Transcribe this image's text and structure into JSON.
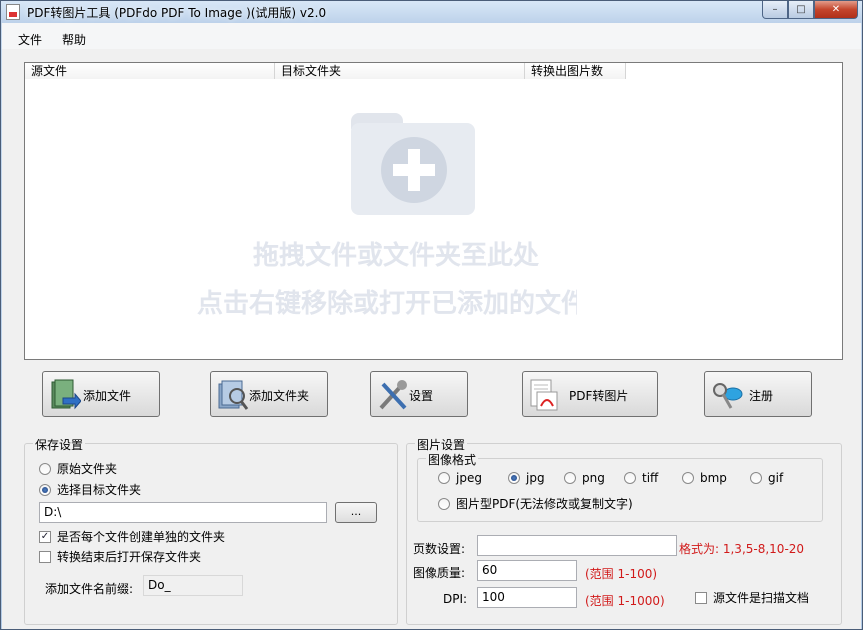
{
  "window": {
    "title": "PDF转图片工具 (PDFdo PDF To Image )(试用版) v2.0",
    "minimize_glyph": "–",
    "maximize_glyph": "□",
    "close_glyph": "✕"
  },
  "menu": {
    "file": "文件",
    "help": "帮助"
  },
  "file_list": {
    "columns": [
      "源文件",
      "目标文件夹",
      "转换出图片数"
    ],
    "drop_hint_line1": "拖拽文件或文件夹至此处",
    "drop_hint_line2": "点击右键移除或打开已添加的文件"
  },
  "toolbar": {
    "add_file": "添加文件",
    "add_folder": "添加文件夹",
    "settings": "设置",
    "convert": "PDF转图片",
    "register": "注册"
  },
  "save_settings": {
    "title": "保存设置",
    "original_folder": "原始文件夹",
    "choose_folder": "选择目标文件夹",
    "selected": "choose_folder",
    "path_value": "D:\\",
    "browse_label": "...",
    "create_subfolder": "是否每个文件创建单独的文件夹",
    "create_subfolder_checked": true,
    "open_after": "转换结束后打开保存文件夹",
    "open_after_checked": false,
    "prefix_label": "添加文件名前缀:",
    "prefix_value": "Do_"
  },
  "image_settings": {
    "title": "图片设置",
    "format_title": "图像格式",
    "formats": [
      "jpeg",
      "jpg",
      "png",
      "tiff",
      "bmp",
      "gif"
    ],
    "selected_format": "jpg",
    "image_pdf": "图片型PDF(无法修改或复制文字)",
    "pages_label": "页数设置:",
    "pages_value": "",
    "pages_hint": "格式为: 1,3,5-8,10-20",
    "quality_label": "图像质量:",
    "quality_value": "60",
    "quality_hint": "(范围 1-100)",
    "dpi_label": "DPI:",
    "dpi_value": "100",
    "dpi_hint": "(范围 1-1000)",
    "scanned_label": "源文件是扫描文档",
    "scanned_checked": false
  },
  "check_glyph": "✓"
}
